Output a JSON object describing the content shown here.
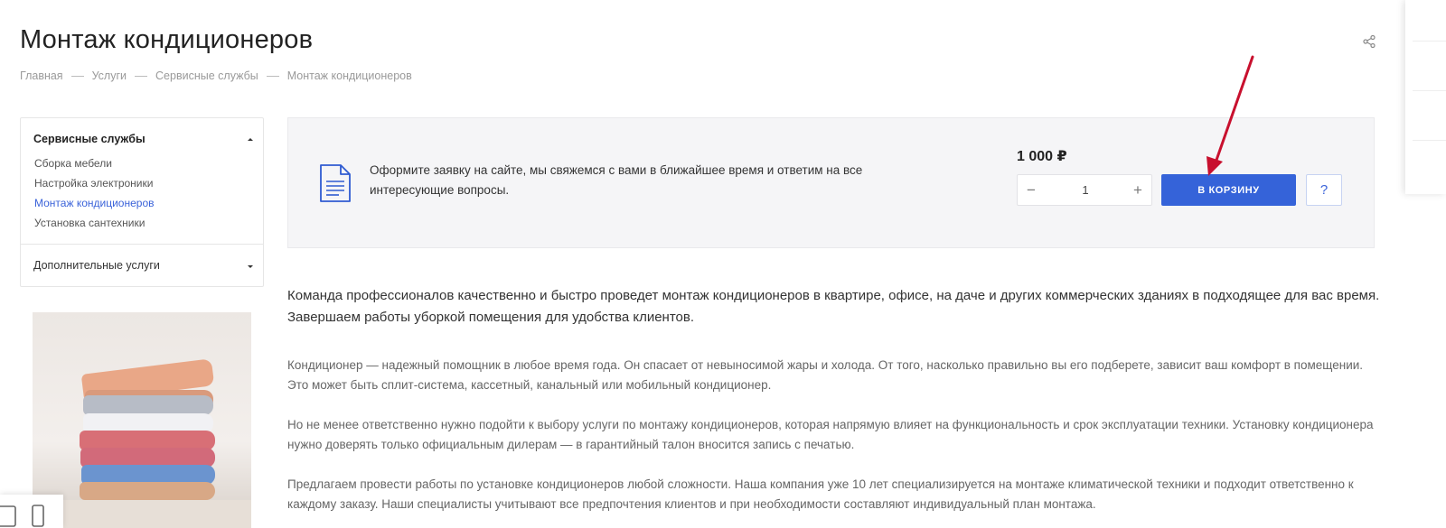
{
  "page": {
    "title": "Монтаж кондиционеров"
  },
  "breadcrumb": [
    "Главная",
    "Услуги",
    "Сервисные службы",
    "Монтаж кондиционеров"
  ],
  "sidebar": {
    "menu_title": "Сервисные службы",
    "items": [
      {
        "label": "Сборка мебели",
        "active": false
      },
      {
        "label": "Настройка электроники",
        "active": false
      },
      {
        "label": "Монтаж кондиционеров",
        "active": true
      },
      {
        "label": "Установка сантехники",
        "active": false
      }
    ],
    "extra_label": "Дополнительные услуги"
  },
  "order": {
    "text": "Оформите заявку на сайте, мы свяжемся с вами в ближайшее время и ответим на все интересующие вопросы.",
    "price": "1 000 ₽",
    "quantity": "1",
    "minus": "−",
    "plus": "+",
    "cart_label": "В КОРЗИНУ",
    "help_label": "?"
  },
  "content": {
    "lead": "Команда профессионалов качественно и быстро проведет монтаж кондиционеров в квартире, офисе, на даче и других коммерческих зданиях в подходящее для вас время. Завершаем работы уборкой помещения для удобства клиентов.",
    "paragraphs": [
      "Кондиционер — надежный помощник в любое время года. Он спасает от невыносимой жары и холода. От того, насколько правильно вы его подберете, зависит ваш комфорт в помещении. Это может быть сплит-система, кассетный, канальный или мобильный кондиционер.",
      "Но не менее ответственно нужно подойти к выбору услуги по монтажу кондиционеров, которая напрямую влияет на функциональность и срок эксплуатации техники. Установку кондиционера нужно доверять только официальным дилерам — в гарантийный талон вносится запись с печатью.",
      "Предлагаем провести работы по установке кондиционеров любой сложности. Наша компания уже 10 лет специализируется на монтаже климатической техники и подходит ответственно к каждому заказу. Наши специалисты учитывают все предпочтения клиентов и при необходимости составляют индивидуальный план монтажа."
    ]
  },
  "colors": {
    "accent": "#3563d9",
    "link_active": "#3b63d9",
    "annotation_arrow": "#c8102e"
  },
  "icons": [
    "share-icon",
    "document-icon",
    "caret-up-icon",
    "caret-down-icon"
  ]
}
